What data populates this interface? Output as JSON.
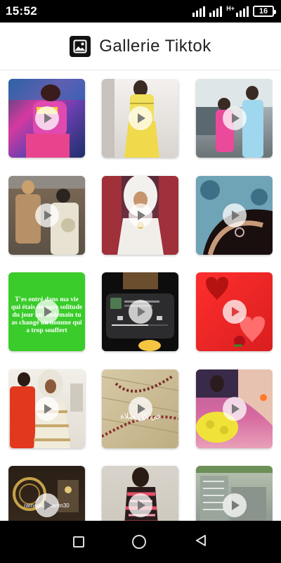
{
  "status_bar": {
    "time": "15:52",
    "network": "H+",
    "battery": "16"
  },
  "header": {
    "title": "Gallerie Tiktok",
    "icon": "gallery-image-icon"
  },
  "gallery": {
    "play_icon": "play-icon",
    "items": [
      {
        "caption": ""
      },
      {
        "caption": ""
      },
      {
        "caption": ""
      },
      {
        "caption": ""
      },
      {
        "caption": ""
      },
      {
        "caption": ""
      },
      {
        "caption": "T'es entré dans ma vie qui étais de pure solitude du jour au lendemain tu as changé un homme qui a trop souffert"
      },
      {
        "caption": ""
      },
      {
        "caption": ""
      },
      {
        "caption": ""
      },
      {
        "caption": "في كل صلاة"
      },
      {
        "caption": ""
      },
      {
        "caption": "ramadan_karim30"
      },
      {
        "caption": ""
      },
      {
        "caption": ""
      }
    ]
  },
  "navigation": {
    "recents": "square-icon",
    "home": "circle-icon",
    "back": "triangle-back-icon"
  }
}
